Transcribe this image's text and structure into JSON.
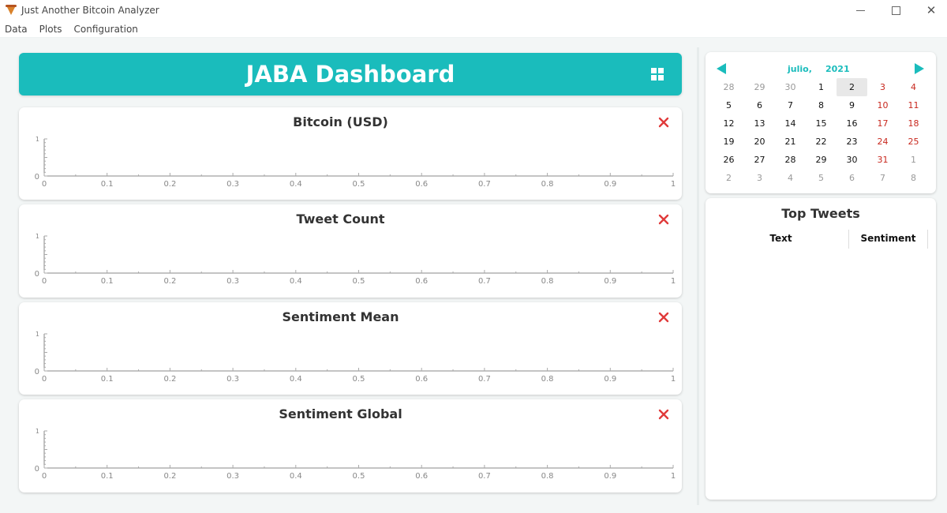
{
  "window": {
    "title": "Just Another Bitcoin Analyzer"
  },
  "menu": [
    "Data",
    "Plots",
    "Configuration"
  ],
  "header": {
    "title": "JABA Dashboard"
  },
  "plots": [
    {
      "title": "Bitcoin (USD)"
    },
    {
      "title": "Tweet Count"
    },
    {
      "title": "Sentiment Mean"
    },
    {
      "title": "Sentiment Global"
    }
  ],
  "axis": {
    "x_ticks": [
      "0",
      "0.1",
      "0.2",
      "0.3",
      "0.4",
      "0.5",
      "0.6",
      "0.7",
      "0.8",
      "0.9",
      "1"
    ],
    "y_ticks": [
      "0",
      "1"
    ]
  },
  "calendar": {
    "month": "julio,",
    "year": "2021",
    "selected_day": "2",
    "weeks": [
      [
        {
          "d": "28",
          "m": 1
        },
        {
          "d": "29",
          "m": 1
        },
        {
          "d": "30",
          "m": 1
        },
        {
          "d": "1"
        },
        {
          "d": "2",
          "s": 1
        },
        {
          "d": "3",
          "w": 1
        },
        {
          "d": "4",
          "w": 1
        }
      ],
      [
        {
          "d": "5"
        },
        {
          "d": "6"
        },
        {
          "d": "7"
        },
        {
          "d": "8"
        },
        {
          "d": "9"
        },
        {
          "d": "10",
          "w": 1
        },
        {
          "d": "11",
          "w": 1
        }
      ],
      [
        {
          "d": "12"
        },
        {
          "d": "13"
        },
        {
          "d": "14"
        },
        {
          "d": "15"
        },
        {
          "d": "16"
        },
        {
          "d": "17",
          "w": 1
        },
        {
          "d": "18",
          "w": 1
        }
      ],
      [
        {
          "d": "19"
        },
        {
          "d": "20"
        },
        {
          "d": "21"
        },
        {
          "d": "22"
        },
        {
          "d": "23"
        },
        {
          "d": "24",
          "w": 1
        },
        {
          "d": "25",
          "w": 1
        }
      ],
      [
        {
          "d": "26"
        },
        {
          "d": "27"
        },
        {
          "d": "28"
        },
        {
          "d": "29"
        },
        {
          "d": "30"
        },
        {
          "d": "31",
          "w": 1
        },
        {
          "d": "1",
          "m": 1
        }
      ],
      [
        {
          "d": "2",
          "m": 1
        },
        {
          "d": "3",
          "m": 1
        },
        {
          "d": "4",
          "m": 1
        },
        {
          "d": "5",
          "m": 1
        },
        {
          "d": "6",
          "m": 1
        },
        {
          "d": "7",
          "m": 1
        },
        {
          "d": "8",
          "m": 1
        }
      ]
    ]
  },
  "tweets": {
    "title": "Top Tweets",
    "columns": [
      "Text",
      "Sentiment"
    ]
  },
  "colors": {
    "accent": "#1abcbc",
    "close": "#e03a3a",
    "weekend": "#c8281e"
  },
  "icons": {
    "app": "pizza-slice-icon",
    "layout": "grid-layout-icon",
    "close": "close-x-icon",
    "prev": "arrow-left-icon",
    "next": "arrow-right-icon"
  }
}
